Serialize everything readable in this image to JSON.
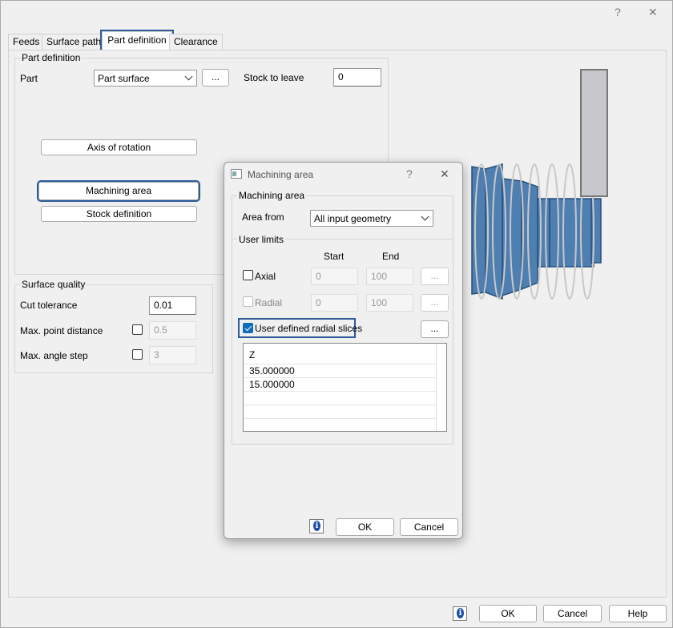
{
  "window": {
    "help_glyph": "?",
    "close_glyph": "✕"
  },
  "tabs": [
    {
      "label": "Feeds",
      "active": false
    },
    {
      "label": "Surface paths",
      "active": false
    },
    {
      "label": "Part definition",
      "active": true
    },
    {
      "label": "Clearance",
      "active": false
    }
  ],
  "part_definition": {
    "group_title": "Part definition",
    "part_label": "Part",
    "part_value": "Part surface",
    "ellipsis": "...",
    "stock_to_leave_label": "Stock to leave",
    "stock_to_leave_value": "0",
    "axis_of_rotation_label": "Axis of rotation",
    "machining_area_label": "Machining area",
    "stock_definition_label": "Stock definition"
  },
  "surface_quality": {
    "group_title": "Surface quality",
    "cut_tolerance_label": "Cut tolerance",
    "cut_tolerance_value": "0.01",
    "max_point_distance_label": "Max. point distance",
    "max_point_distance_value": "0.5",
    "max_angle_step_label": "Max. angle step",
    "max_angle_step_value": "3"
  },
  "dialog": {
    "title": "Machining area",
    "help_glyph": "?",
    "close_glyph": "✕",
    "machining_area_group": "Machining area",
    "area_from_label": "Area from",
    "area_from_value": "All input geometry",
    "user_limits_group": "User limits",
    "start_header": "Start",
    "end_header": "End",
    "axial_label": "Axial",
    "axial_start": "0",
    "axial_end": "100",
    "radial_label": "Radial",
    "radial_start": "0",
    "radial_end": "100",
    "ellipsis": "...",
    "user_defined_label": "User defined radial slices",
    "table_header": "Z",
    "table_rows": [
      "35.000000",
      "15.000000"
    ],
    "ok_label": "OK",
    "cancel_label": "Cancel"
  },
  "footer": {
    "ok_label": "OK",
    "cancel_label": "Cancel",
    "help_label": "Help"
  },
  "colors": {
    "accent": "#2e5b98",
    "part_blue": "#4e7fb0",
    "tool_gray": "#c8c8cc"
  }
}
